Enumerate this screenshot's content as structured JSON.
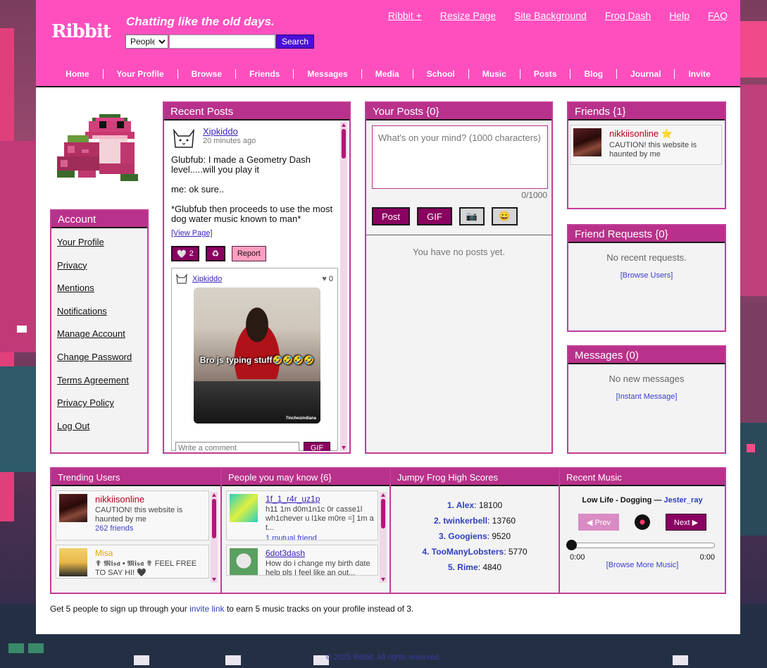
{
  "header": {
    "logo": "Ribbit",
    "tagline": "Chatting like the old days.",
    "search": {
      "selected": "People",
      "placeholder": "",
      "button": "Search"
    },
    "toplinks": [
      "Ribbit +",
      "Resize Page",
      "Site Background",
      "Frog Dash",
      "Help",
      "FAQ"
    ],
    "nav": [
      "Home",
      "Your Profile",
      "Browse",
      "Friends",
      "Messages",
      "Media",
      "School",
      "Music",
      "Posts",
      "Blog",
      "Journal",
      "Invite"
    ]
  },
  "account": {
    "title": "Account",
    "links": [
      "Your Profile",
      "Privacy",
      "Mentions",
      "Notifications",
      "Manage Account",
      "Change Password",
      "Terms Agreement",
      "Privacy Policy",
      "Log Out"
    ]
  },
  "recent_posts": {
    "title": "Recent Posts",
    "post": {
      "user": "Xipkiddo",
      "time": "20 minutes ago",
      "text": "Glubfub: I made a Geometry Dash level.....will you play it\n\nme: ok sure..\n\n*Glubfub then proceeds to use the most dog water music known to man*",
      "view": "[View Page]",
      "likes": "2",
      "report": "Report"
    },
    "comment": {
      "user": "Xipkiddo",
      "likes": "0",
      "caption": "Bro js typing stuff🤣🤣🤣🤣",
      "credit": "7inchesindiana",
      "placeholder": "Write a comment",
      "gif": "GIF"
    }
  },
  "your_posts": {
    "title": "Your Posts {0}",
    "placeholder": "What's on your mind? (1000 characters)",
    "count": "0/1000",
    "post_btn": "Post",
    "gif_btn": "GIF",
    "empty": "You have no posts yet."
  },
  "friends": {
    "title": "Friends {1}",
    "items": [
      {
        "name": "nikkiisonline",
        "bio": "CAUTION! this website is haunted by me"
      }
    ]
  },
  "friend_requests": {
    "title": "Friend Requests {0}",
    "empty": "No recent requests.",
    "link": "[Browse Users]"
  },
  "messages": {
    "title": "Messages (0)",
    "empty": "No new messages",
    "link": "[Instant Message]"
  },
  "trending": {
    "title": "Trending Users",
    "items": [
      {
        "name": "nikkiisonline",
        "bio": "CAUTION! this website is haunted by me",
        "friends": "262 friends"
      },
      {
        "name": "Misa",
        "bio": "✟ 𝕸𝖎𝖘𝖆 • 𝕸𝖎𝖘𝖆 ✟ FEEL FREE TO SAY HI! 🖤"
      }
    ]
  },
  "people": {
    "title": "People you may know {6}",
    "items": [
      {
        "name": "1f_1_r4r_uz1p",
        "bio": "h11 1m d0m1n1c 0r casse1l wh1chever u l1ke m0re =] 1m a t...",
        "mutual": "1 mutual friend"
      },
      {
        "name": "6dot3dash",
        "bio": "How do i change my birth date help pls I feel like an out..."
      }
    ]
  },
  "scores": {
    "title": "Jumpy Frog High Scores",
    "items": [
      {
        "rank": "1. Alex",
        "score": "18100"
      },
      {
        "rank": "2. twinkerbell",
        "score": "13760"
      },
      {
        "rank": "3. Googiens",
        "score": "9520"
      },
      {
        "rank": "4. TooManyLobsters",
        "score": "5770"
      },
      {
        "rank": "5. Rime",
        "score": "4840"
      }
    ]
  },
  "music": {
    "title": "Recent Music",
    "track": "Low Life - Dogging",
    "sep": " — ",
    "artist": "Jester_ray",
    "prev": "◀ Prev",
    "next": "Next ▶",
    "time_start": "0:00",
    "time_end": "0:00",
    "progress": 0,
    "link": "[Browse More Music]"
  },
  "invite_note": {
    "before": "Get 5 people to sign up through your ",
    "link": "invite link",
    "after": " to earn 5 music tracks on your profile instead of 3."
  },
  "footer": "© 2025 Ribbit. All rights reserved."
}
